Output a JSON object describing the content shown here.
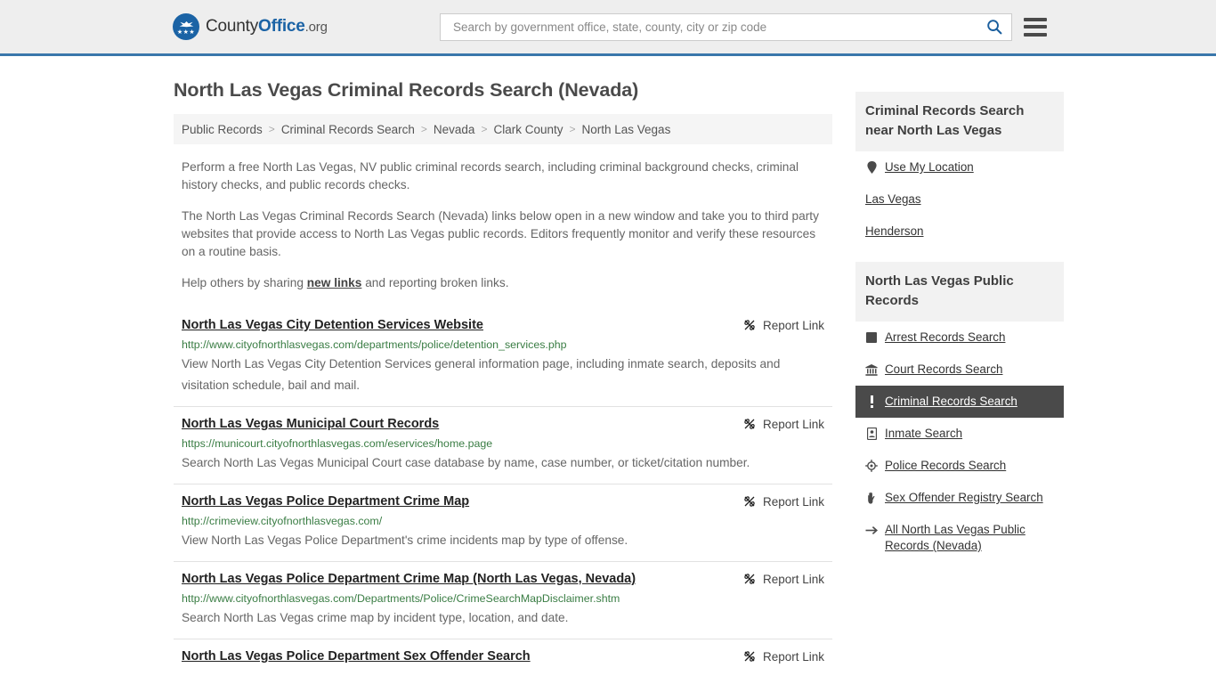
{
  "header": {
    "logo": {
      "part1": "County",
      "part2": "Office",
      "part3": ".org",
      "icon": "eagle-badge-icon"
    },
    "search": {
      "placeholder": "Search by government office, state, county, city or zip code",
      "value": "",
      "icon": "search-icon"
    },
    "menu_icon": "hamburger-menu-icon",
    "accent_color": "#3a77ab"
  },
  "main": {
    "title": "North Las Vegas Criminal Records Search (Nevada)",
    "breadcrumb": [
      "Public Records",
      "Criminal Records Search",
      "Nevada",
      "Clark County",
      "North Las Vegas"
    ],
    "breadcrumb_separator": ">",
    "intro": [
      "Perform a free North Las Vegas, NV public criminal records search, including criminal background checks, criminal history checks, and public records checks.",
      "The North Las Vegas Criminal Records Search (Nevada) links below open in a new window and take you to third party websites that provide access to North Las Vegas public records. Editors frequently monitor and verify these resources on a routine basis."
    ],
    "share_prefix": "Help others by sharing ",
    "share_link": "new links",
    "share_suffix": " and reporting broken links.",
    "report_link_label": "Report Link",
    "report_link_icon": "broken-link-icon",
    "results": [
      {
        "title": "North Las Vegas City Detention Services Website",
        "url": "http://www.cityofnorthlasvegas.com/departments/police/detention_services.php",
        "desc": "View North Las Vegas City Detention Services general information page, including inmate search, deposits and visitation schedule, bail and mail."
      },
      {
        "title": "North Las Vegas Municipal Court Records",
        "url": "https://municourt.cityofnorthlasvegas.com/eservices/home.page",
        "desc": "Search North Las Vegas Municipal Court case database by name, case number, or ticket/citation number."
      },
      {
        "title": "North Las Vegas Police Department Crime Map",
        "url": "http://crimeview.cityofnorthlasvegas.com/",
        "desc": "View North Las Vegas Police Department's crime incidents map by type of offense."
      },
      {
        "title": "North Las Vegas Police Department Crime Map (North Las Vegas, Nevada)",
        "url": "http://www.cityofnorthlasvegas.com/Departments/Police/CrimeSearchMapDisclaimer.shtm",
        "desc": "Search North Las Vegas crime map by incident type, location, and date."
      },
      {
        "title": "North Las Vegas Police Department Sex Offender Search",
        "url": "",
        "desc": ""
      }
    ]
  },
  "sidebar": {
    "nearby": {
      "heading": "Criminal Records Search near North Las Vegas",
      "items": [
        {
          "label": "Use My Location",
          "icon": "map-pin-icon",
          "active": false
        },
        {
          "label": "Las Vegas",
          "icon": "none",
          "active": false
        },
        {
          "label": "Henderson",
          "icon": "none",
          "active": false
        }
      ]
    },
    "records": {
      "heading": "North Las Vegas Public Records",
      "items": [
        {
          "label": "Arrest Records Search",
          "icon": "square-icon",
          "active": false
        },
        {
          "label": "Court Records Search",
          "icon": "courthouse-icon",
          "active": false
        },
        {
          "label": "Criminal Records Search",
          "icon": "exclamation-icon",
          "active": true
        },
        {
          "label": "Inmate Search",
          "icon": "id-card-icon",
          "active": false
        },
        {
          "label": "Police Records Search",
          "icon": "police-badge-icon",
          "active": false
        },
        {
          "label": "Sex Offender Registry Search",
          "icon": "hand-icon",
          "active": false
        },
        {
          "label": "All North Las Vegas Public Records (Nevada)",
          "icon": "arrow-right-icon",
          "active": false
        }
      ]
    },
    "active_bg": "#4a4a4a"
  }
}
